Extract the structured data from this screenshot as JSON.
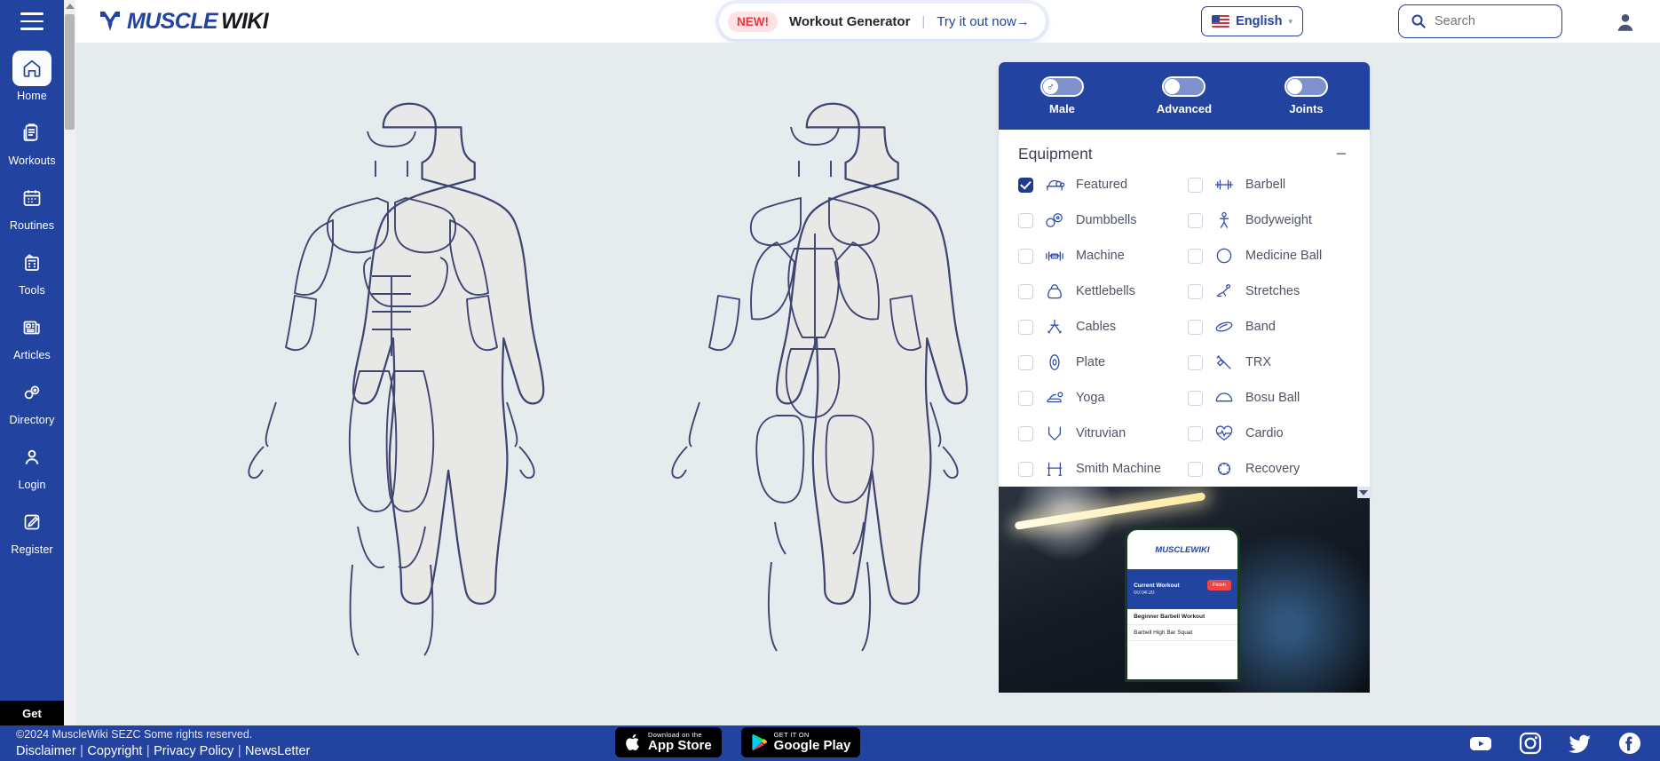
{
  "sidebar": {
    "menu_icon": "hamburger-icon",
    "items": [
      {
        "label": "Home",
        "icon": "home-icon",
        "active": true
      },
      {
        "label": "Workouts",
        "icon": "clipboard-icon",
        "active": false
      },
      {
        "label": "Routines",
        "icon": "calendar-icon",
        "active": false
      },
      {
        "label": "Tools",
        "icon": "calculator-icon",
        "active": false
      },
      {
        "label": "Articles",
        "icon": "news-icon",
        "active": false
      },
      {
        "label": "Directory",
        "icon": "dumbbell-icon",
        "active": false
      },
      {
        "label": "Login",
        "icon": "user-icon",
        "active": false
      },
      {
        "label": "Register",
        "icon": "pencil-icon",
        "active": false
      }
    ],
    "get_label": "Get"
  },
  "header": {
    "logo_primary": "MUSCLE",
    "logo_secondary": "WIKI",
    "promo": {
      "badge": "NEW!",
      "title": "Workout Generator",
      "separator": "|",
      "cta": "Try it out now→"
    },
    "language": {
      "label": "English",
      "caret": "▾",
      "flag_icon": "us-flag-icon"
    },
    "search": {
      "placeholder": "Search",
      "icon": "search-icon"
    },
    "account_icon": "user-account-icon"
  },
  "filters": {
    "toggles": [
      {
        "label": "Male",
        "icon": "male-symbol",
        "glyph": "♂",
        "on": false
      },
      {
        "label": "Advanced",
        "icon": "toggle",
        "glyph": "",
        "on": false
      },
      {
        "label": "Joints",
        "icon": "toggle",
        "glyph": "",
        "on": false
      }
    ],
    "equipment": {
      "title": "Equipment",
      "collapse_glyph": "−",
      "items": [
        {
          "label": "Featured",
          "icon": "bench-icon",
          "checked": true
        },
        {
          "label": "Barbell",
          "icon": "barbell-icon",
          "checked": false
        },
        {
          "label": "Dumbbells",
          "icon": "dumbbells-icon",
          "checked": false
        },
        {
          "label": "Bodyweight",
          "icon": "bodyweight-icon",
          "checked": false
        },
        {
          "label": "Machine",
          "icon": "machine-icon",
          "checked": false
        },
        {
          "label": "Medicine Ball",
          "icon": "medicine-ball-icon",
          "checked": false
        },
        {
          "label": "Kettlebells",
          "icon": "kettlebell-icon",
          "checked": false
        },
        {
          "label": "Stretches",
          "icon": "stretches-icon",
          "checked": false
        },
        {
          "label": "Cables",
          "icon": "cables-icon",
          "checked": false
        },
        {
          "label": "Band",
          "icon": "band-icon",
          "checked": false
        },
        {
          "label": "Plate",
          "icon": "plate-icon",
          "checked": false
        },
        {
          "label": "TRX",
          "icon": "trx-icon",
          "checked": false
        },
        {
          "label": "Yoga",
          "icon": "yoga-icon",
          "checked": false
        },
        {
          "label": "Bosu Ball",
          "icon": "bosu-ball-icon",
          "checked": false
        },
        {
          "label": "Vitruvian",
          "icon": "vitruvian-icon",
          "checked": false
        },
        {
          "label": "Cardio",
          "icon": "cardio-icon",
          "checked": false
        },
        {
          "label": "Smith Machine",
          "icon": "smith-machine-icon",
          "checked": false
        },
        {
          "label": "Recovery",
          "icon": "recovery-icon",
          "checked": false
        }
      ]
    }
  },
  "ad": {
    "brand": "MUSCLEWIKI",
    "current_workout": "Current Workout",
    "timer": "00:04:20",
    "finish_label": "Finish",
    "workout_title": "Beginner Barbell Workout",
    "exercise": "Barbell High Bar Squat",
    "close_label": "×"
  },
  "footer": {
    "copyright": "©2024 MuscleWiki SEZC Some rights reserved.",
    "links": [
      "Disclaimer",
      "Copyright",
      "Privacy Policy",
      "NewsLetter"
    ],
    "separator": "|",
    "app_store": {
      "small": "Download on the",
      "big": "App Store",
      "icon": "apple-icon"
    },
    "google_play": {
      "small": "GET IT ON",
      "big": "Google Play",
      "icon": "play-icon"
    },
    "socials": [
      "youtube-icon",
      "instagram-icon",
      "twitter-icon",
      "facebook-icon"
    ]
  },
  "body_map": {
    "front_label": "front-body-diagram",
    "back_label": "back-body-diagram"
  },
  "colors": {
    "brand_blue": "#2343a0",
    "canvas": "#e6ebee",
    "accent_red": "#f0333c",
    "body_fill": "#e8e8e6",
    "body_stroke": "#3f4470"
  }
}
